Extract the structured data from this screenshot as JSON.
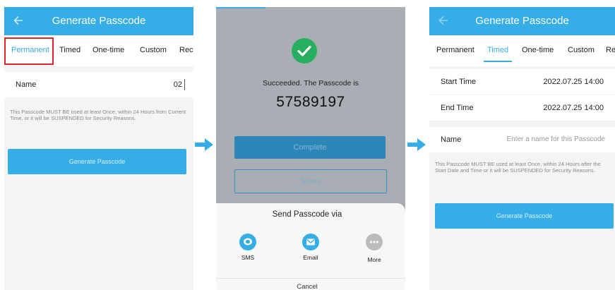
{
  "colors": {
    "brand": "#35aee8",
    "success": "#27ae60",
    "highlight": "#e02424"
  },
  "screen1": {
    "title": "Generate Passcode",
    "back_icon": "arrow-left-icon",
    "tabs": [
      "Permanent",
      "Timed",
      "One-time",
      "Custom",
      "Rec"
    ],
    "active_tab": "Permanent",
    "name_label": "Name",
    "name_value": "02",
    "note": "This Passcode MUST BE used at least Once, within 24 Hours from Current Time, or it will be SUSPENDED for Security Reasons.",
    "button": "Generate Passcode"
  },
  "screen2": {
    "success_icon": "check-circle-icon",
    "message": "Succeeded. The Passcode is",
    "passcode": "57589197",
    "complete_button": "Complete",
    "share_button": "Share",
    "sheet": {
      "title": "Send Passcode via",
      "options": [
        {
          "label": "SMS",
          "icon": "sms-icon"
        },
        {
          "label": "Email",
          "icon": "email-icon"
        },
        {
          "label": "More",
          "icon": "more-icon"
        }
      ],
      "cancel": "Cancel"
    }
  },
  "screen3": {
    "title": "Generate Passcode",
    "back_icon": "arrow-left-icon",
    "tabs": [
      "Permanent",
      "Timed",
      "One-time",
      "Custom",
      "Rec"
    ],
    "active_tab": "Timed",
    "start_label": "Start Time",
    "start_value": "2022.07.25 14:00",
    "end_label": "End Time",
    "end_value": "2022.07.25 14:00",
    "name_label": "Name",
    "name_placeholder": "Enter a name for this Passcode",
    "note": "This Passcode MUST BE used at least Once, within 24 Hours after the Start Date and Time or it will be SUSPENDED for Security Reasons.",
    "button": "Generate Passcode"
  },
  "step_arrow_icon": "arrow-right-icon"
}
